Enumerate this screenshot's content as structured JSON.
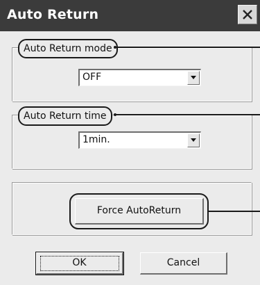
{
  "window": {
    "title": "Auto Return",
    "close_icon": "close-x-icon"
  },
  "mode_group": {
    "label": "Auto Return mode",
    "select": {
      "value": "OFF",
      "arrow_icon": "dropdown-arrow-icon"
    }
  },
  "time_group": {
    "label": "Auto Return time",
    "select": {
      "value": "1min.",
      "arrow_icon": "dropdown-arrow-icon"
    }
  },
  "force_group": {
    "button_label": "Force AutoReturn"
  },
  "footer": {
    "ok_label": "OK",
    "cancel_label": "Cancel"
  },
  "colors": {
    "titlebar": "#3b3b3b",
    "dialog_background": "#ebebeb",
    "callout_outline": "#1a1a1a"
  }
}
